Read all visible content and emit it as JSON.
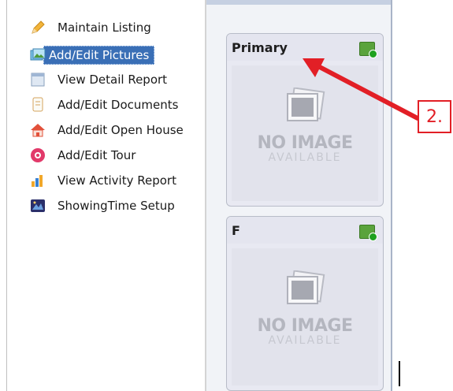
{
  "menu": {
    "items": [
      {
        "label": "Maintain Listing",
        "icon": "pencil-icon",
        "selected": false
      },
      {
        "label": "Add/Edit Pictures",
        "icon": "pictures-icon",
        "selected": true
      },
      {
        "label": "View Detail Report",
        "icon": "report-icon",
        "selected": false
      },
      {
        "label": "Add/Edit Documents",
        "icon": "document-icon",
        "selected": false
      },
      {
        "label": "Add/Edit Open House",
        "icon": "open-house-icon",
        "selected": false
      },
      {
        "label": "Add/Edit Tour",
        "icon": "tour-icon",
        "selected": false
      },
      {
        "label": "View Activity Report",
        "icon": "activity-chart-icon",
        "selected": false
      },
      {
        "label": "ShowingTime Setup",
        "icon": "showingtime-icon",
        "selected": false
      }
    ]
  },
  "photos": {
    "cards": [
      {
        "title": "Primary",
        "placeholder_main": "NO IMAGE",
        "placeholder_sub": "AVAILABLE"
      },
      {
        "title": "F",
        "placeholder_main": "NO IMAGE",
        "placeholder_sub": "AVAILABLE"
      }
    ]
  },
  "callout": {
    "label": "2.",
    "color": "#e21f26"
  },
  "colors": {
    "selected_bg": "#3a6fb6",
    "panel_bg": "#f1f3f7",
    "add_button": "#5aa33c"
  }
}
